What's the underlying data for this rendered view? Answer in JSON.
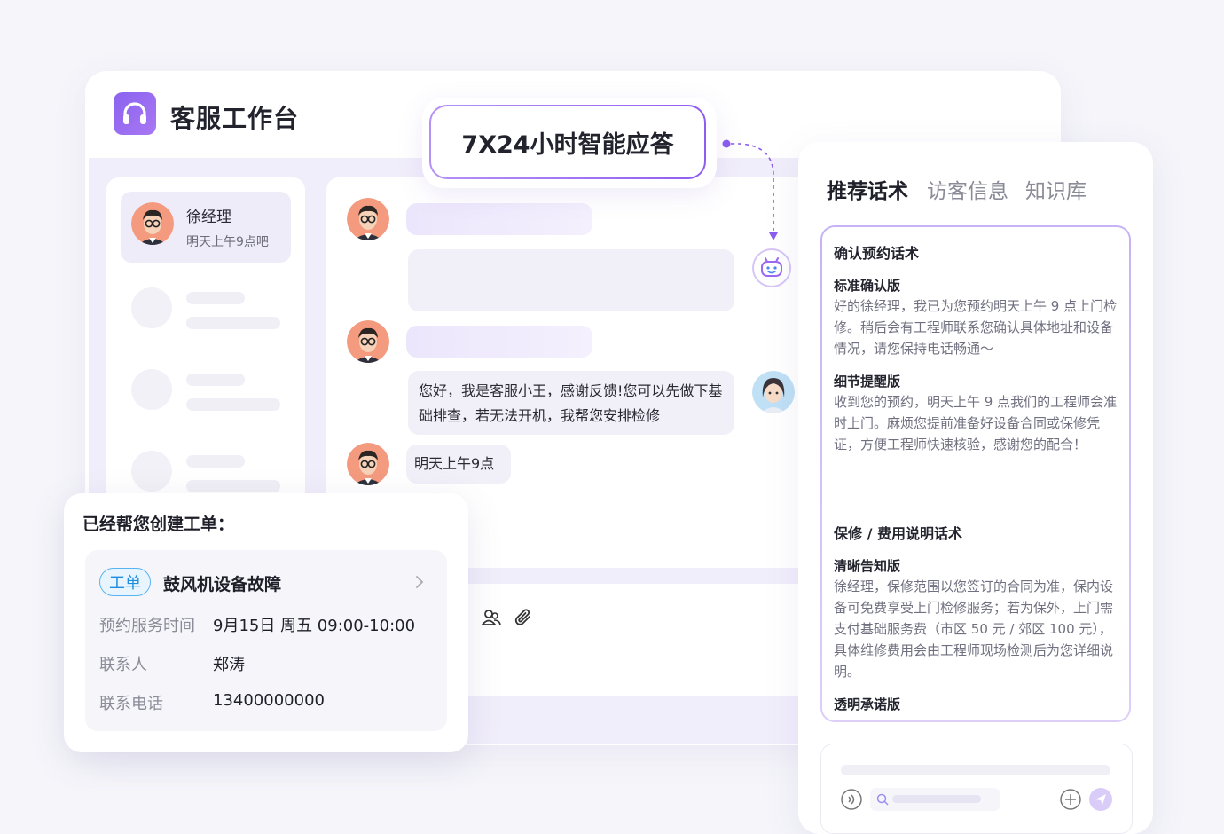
{
  "header": {
    "title": "客服工作台"
  },
  "callout": {
    "text": "7X24小时智能应答"
  },
  "conversations": {
    "active": {
      "name": "徐经理",
      "preview": "明天上午9点吧"
    }
  },
  "chat": {
    "messages": [
      {
        "from": "agent",
        "text": "您好，我是客服小王，感谢反馈!您可以先做下基础排查，若无法开机，我帮您安排检修"
      },
      {
        "from": "customer",
        "text": "明天上午9点"
      }
    ]
  },
  "suggestions": {
    "tabs": [
      "推荐话术",
      "访客信息",
      "知识库"
    ],
    "groups": [
      {
        "title": "确认预约话术",
        "items": [
          {
            "label": "标准确认版",
            "text": "好的徐经理，我已为您预约明天上午 9 点上门检修。稍后会有工程师联系您确认具体地址和设备情况，请您保持电话畅通～"
          },
          {
            "label": "细节提醒版",
            "text": "收到您的预约，明天上午 9 点我们的工程师会准时上门。麻烦您提前准备好设备合同或保修凭证，方便工程师快速核验，感谢您的配合！"
          }
        ]
      },
      {
        "title": "保修 / 费用说明话术",
        "items": [
          {
            "label": "清晰告知版",
            "text": "徐经理，保修范围以您签订的合同为准，保内设备可免费享受上门检修服务；若为保外，上门需支付基础服务费（市区 50 元 / 郊区 100 元），具体维修费用会由工程师现场检测后为您详细说明。"
          },
          {
            "label": "透明承诺版",
            "text": ""
          }
        ]
      }
    ]
  },
  "work_order": {
    "heading": "已经帮您创建工单：",
    "tag": "工单",
    "title": "鼓风机设备故障",
    "fields": [
      {
        "label": "预约服务时间",
        "value": "9月15日 周五 09:00-10:00"
      },
      {
        "label": "联系人",
        "value": "郑涛"
      },
      {
        "label": "联系电话",
        "value": "13400000000"
      }
    ]
  },
  "colors": {
    "accent": "#8b5cf0",
    "tag_blue": "#1d8de0"
  }
}
